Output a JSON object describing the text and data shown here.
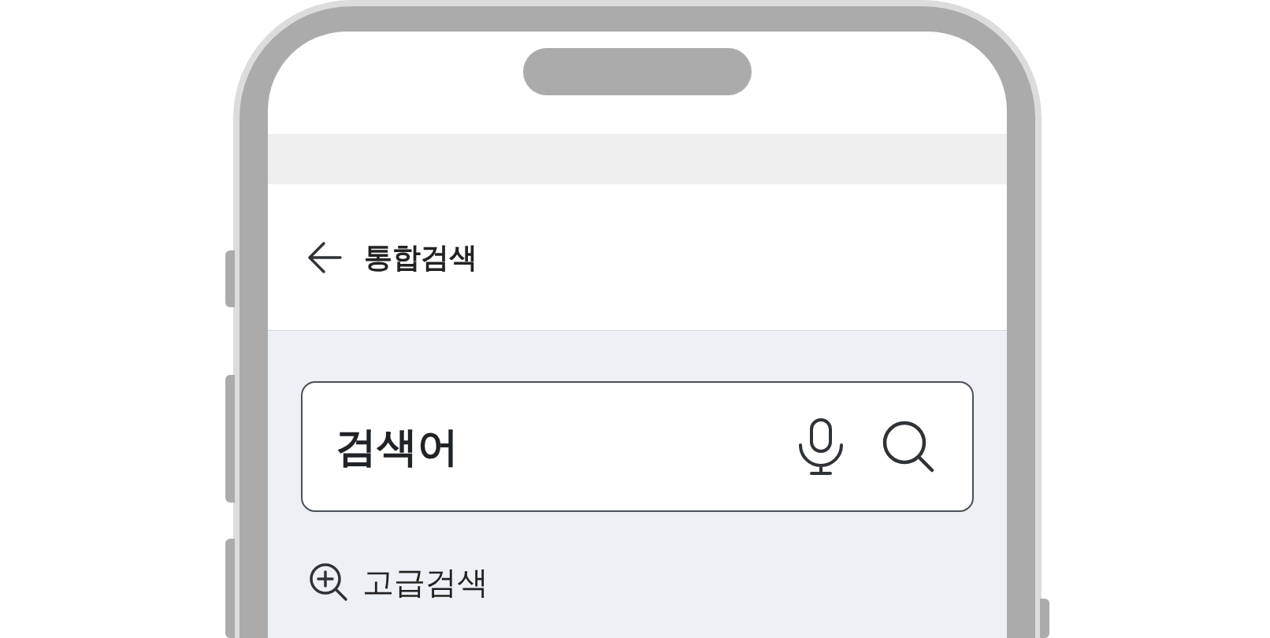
{
  "header": {
    "title": "통합검색"
  },
  "search": {
    "placeholder": "검색어"
  },
  "advanced_search": {
    "label": "고급검색"
  }
}
